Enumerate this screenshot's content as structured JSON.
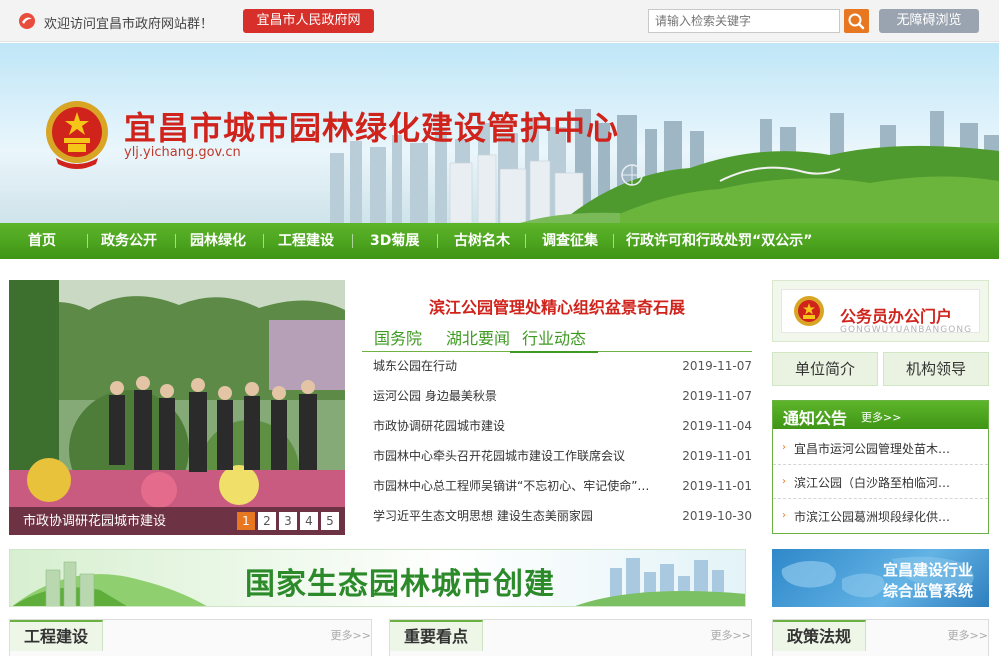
{
  "topbar": {
    "welcome": "欢迎访问宜昌市政府网站群！",
    "gov_link": "宜昌市人民政府网",
    "search_placeholder": "请输入检索关键字",
    "accessibility": "无障碍浏览"
  },
  "banner": {
    "title": "宜昌市城市园林绿化建设管护中心",
    "url": "ylj.yichang.gov.cn"
  },
  "nav": [
    "首页",
    "政务公开",
    "园林绿化",
    "工程建设",
    "3D菊展",
    "古树名木",
    "调查征集",
    "行政许可和行政处罚“双公示”"
  ],
  "slideshow": {
    "caption": "市政协调研花园城市建设",
    "pages": [
      "1",
      "2",
      "3",
      "4",
      "5"
    ],
    "active_page": "1"
  },
  "news": {
    "headline": "滨江公园管理处精心组织盆景奇石展",
    "tabs": [
      "国务院",
      "湖北要闻",
      "行业动态"
    ],
    "active_tab": "行业动态",
    "items": [
      {
        "title": "城东公园在行动",
        "date": "2019-11-07"
      },
      {
        "title": "运河公园 身边最美秋景",
        "date": "2019-11-07"
      },
      {
        "title": "市政协调研花园城市建设",
        "date": "2019-11-04"
      },
      {
        "title": "市园林中心牵头召开花园城市建设工作联席会议",
        "date": "2019-11-01"
      },
      {
        "title": "市园林中心总工程师吴镝讲“不忘初心、牢记使命”…",
        "date": "2019-11-01"
      },
      {
        "title": "学习近平生态文明思想 建设生态美丽家园",
        "date": "2019-10-30"
      }
    ]
  },
  "sidebar": {
    "portal_title": "公务员办公门户",
    "portal_sub": "GONGWUYUANBANGONG",
    "unit_intro": "单位简介",
    "leaders": "机构领导",
    "notice_title": "通知公告",
    "notice_more": "更多>>",
    "notices": [
      "宜昌市运河公园管理处苗木…",
      "滨江公园（白沙路至柏临河…",
      "市滨江公园葛洲坝段绿化供…"
    ]
  },
  "banners": {
    "eco": "国家生态园林城市创建",
    "system_line1": "宜昌建设行业",
    "system_line2": "综合监管系统"
  },
  "sections": [
    {
      "title": "工程建设",
      "more": "更多>>"
    },
    {
      "title": "重要看点",
      "more": "更多>>"
    },
    {
      "title": "政策法规",
      "more": "更多>>"
    }
  ],
  "colors": {
    "accent_red": "#d0231c",
    "nav_green": "#4ca41f",
    "orange": "#e87722"
  }
}
